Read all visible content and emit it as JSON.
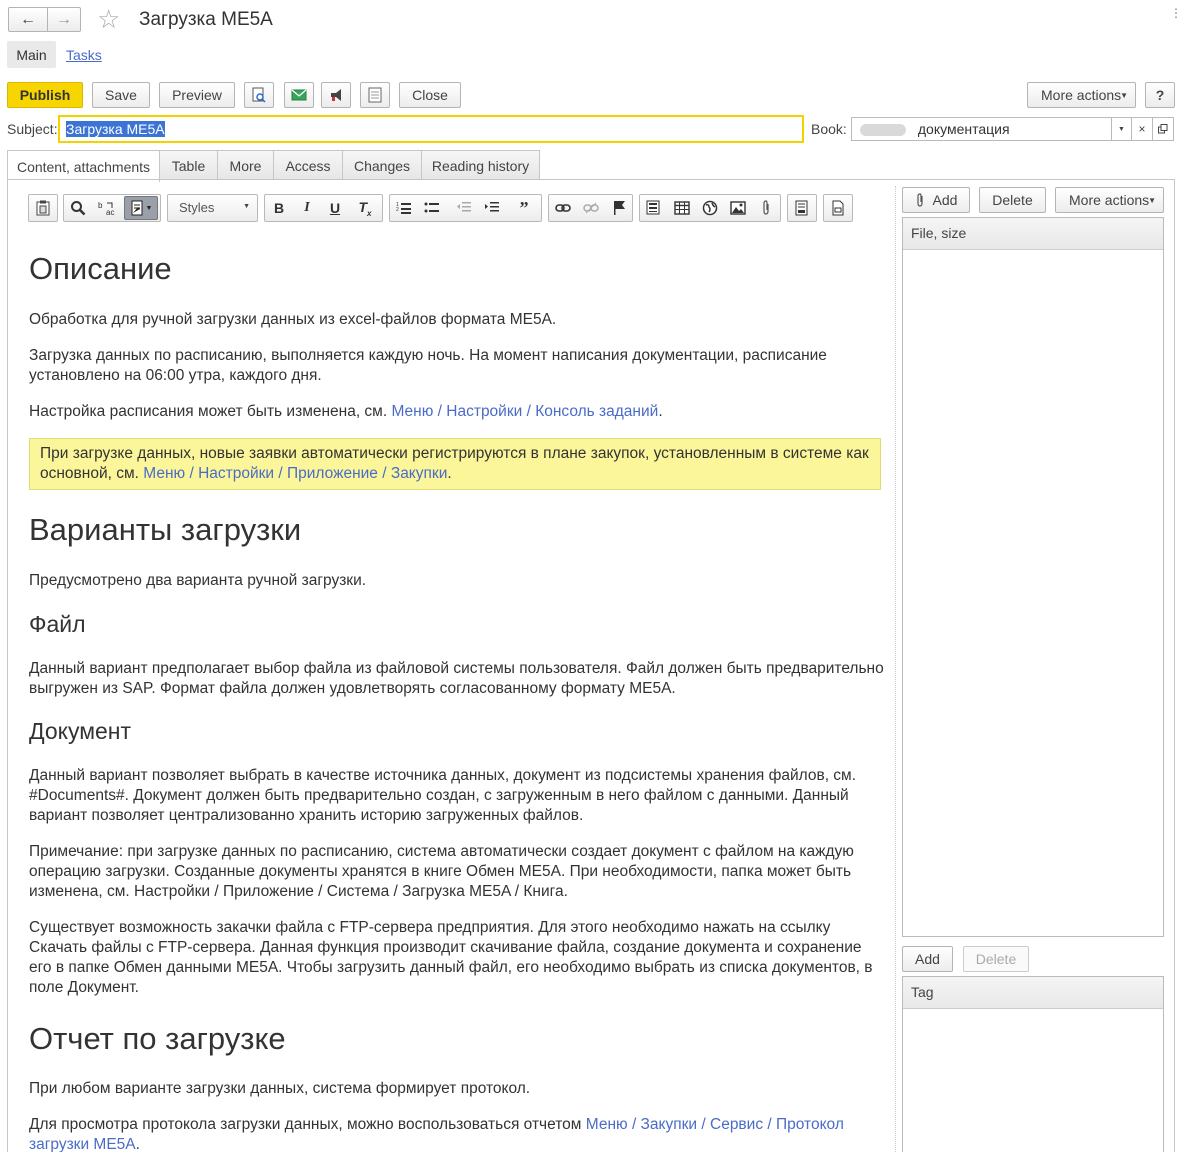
{
  "window": {
    "title": "Загрузка ME5A",
    "nav": {
      "back": "←",
      "forward": "→",
      "star": "☆"
    },
    "top_tabs": [
      {
        "label": "Main"
      },
      {
        "label": "Tasks"
      }
    ]
  },
  "toolbar": {
    "publish": "Publish",
    "save": "Save",
    "preview": "Preview",
    "close": "Close",
    "more_actions": "More actions",
    "help": "?"
  },
  "subject": {
    "label": "Subject:",
    "value": "Загрузка ME5A"
  },
  "book": {
    "label": "Book:",
    "value": "документация"
  },
  "tabs": [
    {
      "label": "Content, attachments"
    },
    {
      "label": "Table"
    },
    {
      "label": "More"
    },
    {
      "label": "Access"
    },
    {
      "label": "Changes"
    },
    {
      "label": "Reading history"
    }
  ],
  "editor": {
    "styles_label": "Styles"
  },
  "doc": {
    "h_description": "Описание",
    "p1": "Обработка для ручной загрузки данных из excel-файлов формата ME5A.",
    "p2": "Загрузка данных по расписанию, выполняется каждую ночь. На момент написания документации, расписание установлено на 06:00 утра, каждого дня.",
    "p3_text": "Настройка расписания может быть изменена, см. ",
    "p3_link": "Меню / Настройки / Консоль заданий",
    "p3_end": ".",
    "note_text": "При загрузке данных, новые заявки автоматически регистрируются в плане закупок, установленным в системе как основной, см. ",
    "note_link": "Меню / Настройки / Приложение / Закупки",
    "note_end": ".",
    "h_variants": "Варианты загрузки",
    "p4": "Предусмотрено два варианта ручной загрузки.",
    "h_file": "Файл",
    "p5": "Данный вариант предполагает выбор файла из файловой системы пользователя. Файл должен быть предварительно выгружен из SAP. Формат файла должен удовлетворять согласованному формату ME5A.",
    "h_document": "Документ",
    "p6": "Данный вариант позволяет выбрать в качестве источника данных, документ из подсистемы хранения файлов, см. #Documents#. Документ должен быть предварительно создан, с загруженным в него файлом с данными. Данный вариант позволяет централизованно хранить историю загруженных файлов.",
    "p7": "Примечание: при загрузке данных по расписанию, система автоматически создает документ с файлом на каждую операцию загрузки. Созданные документы хранятся в книге Обмен ME5A. При необходимости, папка может быть изменена, см. Настройки / Приложение / Система / Загрузка ME5A / Книга.",
    "p8": "Существует возможность закачки файла с FTP-сервера предприятия. Для этого необходимо нажать на ссылку Скачать файлы с FTP-сервера. Данная функция производит скачивание файла, создание документа и сохранение его в папке Обмен данными ME5A. Чтобы загрузить данный файл, его необходимо выбрать из списка документов, в поле Документ.",
    "h_report": "Отчет по загрузке",
    "p9": "При любом варианте загрузки данных, система формирует протокол.",
    "p10_text": "Для просмотра протокола загрузки данных, можно воспользоваться отчетом ",
    "p10_link": "Меню / Закупки / Сервис / Протокол загрузки ME5A",
    "p10_end": "."
  },
  "attachments": {
    "add": "Add",
    "delete": "Delete",
    "more_actions": "More actions",
    "column": "File, size"
  },
  "tags": {
    "add": "Add",
    "delete": "Delete",
    "column": "Tag"
  },
  "colors": {
    "accent": "#f6d500",
    "link": "#4a6cc8",
    "note_bg": "#fbf69a"
  }
}
